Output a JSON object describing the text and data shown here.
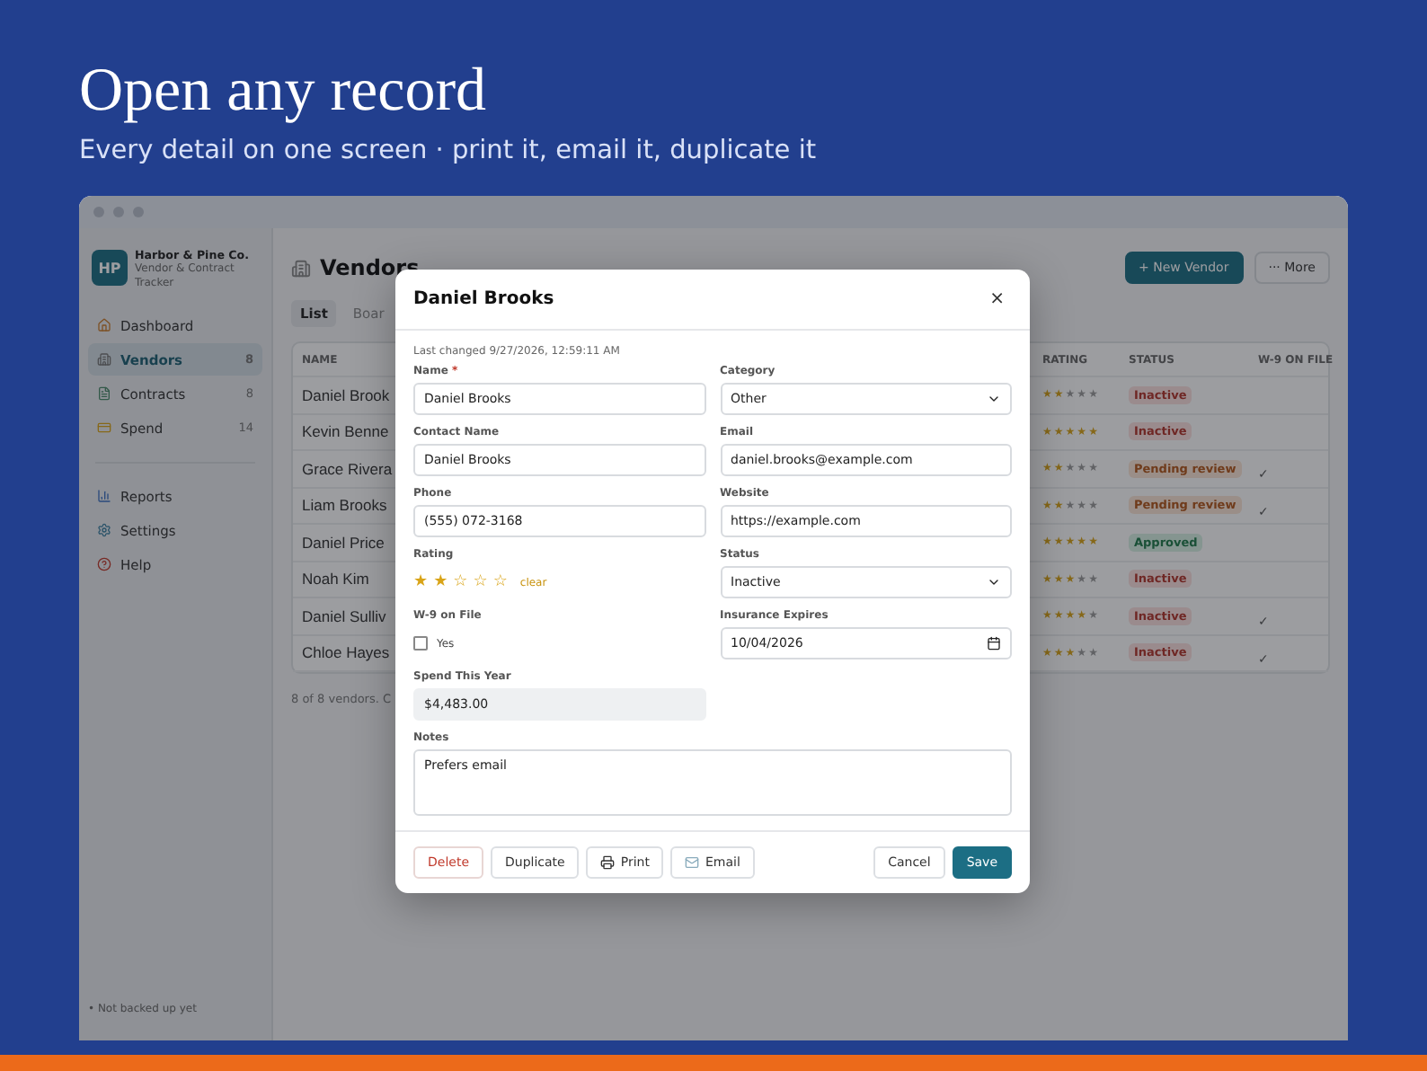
{
  "hero": {
    "title": "Open any record",
    "subtitle": "Every detail on one screen · print it, email it, duplicate it"
  },
  "sidebar": {
    "logo": "HP",
    "brand": "Harbor & Pine Co.",
    "tagline": "Vendor & Contract Tracker",
    "items": [
      {
        "label": "Dashboard",
        "selected": false
      },
      {
        "label": "Vendors",
        "count": "8",
        "selected": true
      },
      {
        "label": "Contracts",
        "count": "8",
        "selected": false
      },
      {
        "label": "Spend",
        "count": "14",
        "selected": false
      }
    ],
    "bottom_items": [
      {
        "label": "Reports",
        "selected": false
      },
      {
        "label": "Settings",
        "selected": false
      },
      {
        "label": "Help",
        "selected": false
      }
    ],
    "footer": "• Not backed up yet"
  },
  "page": {
    "title": "Vendors",
    "new_button": "+ New Vendor",
    "more_button": "··· More",
    "tabs": [
      {
        "label": "List",
        "selected": true
      },
      {
        "label": "Boar",
        "selected": false
      }
    ],
    "table": {
      "columns": [
        "NAME",
        "RATING",
        "STATUS",
        "W-9 ON FILE"
      ],
      "rows": [
        {
          "name": "Daniel Brook",
          "stars": 2,
          "status": {
            "label": "Inactive",
            "kind": "inactive"
          },
          "w9": false
        },
        {
          "name": "Kevin Benne",
          "stars": 5,
          "status": {
            "label": "Inactive",
            "kind": "inactive"
          },
          "w9": false
        },
        {
          "name": "Grace Rivera",
          "stars": 2,
          "status": {
            "label": "Pending review",
            "kind": "pending"
          },
          "w9": true
        },
        {
          "name": "Liam Brooks",
          "stars": 2,
          "status": {
            "label": "Pending review",
            "kind": "pending"
          },
          "w9": true
        },
        {
          "name": "Daniel Price",
          "stars": 5,
          "status": {
            "label": "Approved",
            "kind": "approved"
          },
          "w9": false
        },
        {
          "name": "Noah Kim",
          "stars": 3,
          "status": {
            "label": "Inactive",
            "kind": "inactive"
          },
          "w9": false
        },
        {
          "name": "Daniel Sulliv",
          "stars": 4,
          "status": {
            "label": "Inactive",
            "kind": "inactive"
          },
          "w9": true
        },
        {
          "name": "Chloe Hayes",
          "stars": 3,
          "status": {
            "label": "Inactive",
            "kind": "inactive"
          },
          "w9": true
        }
      ],
      "check_mark": "✓",
      "footnote": "8 of 8 vendors. C"
    }
  },
  "modal": {
    "title": "Daniel Brooks",
    "close": "×",
    "last_changed": "Last changed 9/27/2026, 12:59:11 AM",
    "fields": [
      {
        "kind": "text",
        "label": "Name",
        "required_mark": "*",
        "value": "Daniel Brooks"
      },
      {
        "kind": "select",
        "label": "Category",
        "value": "Other"
      },
      {
        "kind": "text",
        "label": "Contact Name",
        "value": "Daniel Brooks"
      },
      {
        "kind": "text",
        "label": "Email",
        "value": "daniel.brooks@example.com"
      },
      {
        "kind": "text",
        "label": "Phone",
        "value": "(555) 072-3168"
      },
      {
        "kind": "text",
        "label": "Website",
        "value": "https://example.com"
      },
      {
        "kind": "stars",
        "label": "Rating",
        "stars": 2,
        "clear": "clear"
      },
      {
        "kind": "select",
        "label": "Status",
        "value": "Inactive"
      },
      {
        "kind": "checkbox",
        "label": "W-9 on File",
        "checked": false,
        "option": "Yes"
      },
      {
        "kind": "date",
        "label": "Insurance Expires",
        "value": "10/04/2026"
      },
      {
        "kind": "readonly",
        "label": "Spend This Year",
        "value": "$4,483.00"
      },
      {
        "kind": "textarea",
        "label": "Notes",
        "value": "Prefers email"
      }
    ],
    "buttons": [
      {
        "label": "Delete",
        "kind": "danger"
      },
      {
        "label": "Duplicate",
        "kind": "plain"
      },
      {
        "label": "Print",
        "kind": "print"
      },
      {
        "label": "Email",
        "kind": "email"
      }
    ],
    "right_buttons": [
      {
        "label": "Cancel",
        "kind": "plain"
      },
      {
        "label": "Save",
        "kind": "primary"
      }
    ]
  }
}
